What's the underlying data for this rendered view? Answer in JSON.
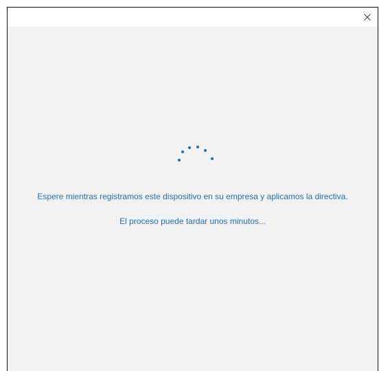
{
  "window": {
    "close_icon": "close-icon"
  },
  "spinner": {
    "icon": "loading-dots-icon",
    "color": "#1f6fb2"
  },
  "messages": {
    "primary": "Espere mientras registramos este dispositivo en su empresa y aplicamos la directiva.",
    "secondary": "El proceso puede tardar unos minutos..."
  },
  "colors": {
    "accent_text": "#1f6fb2",
    "background": "#f2f2f2",
    "titlebar": "#ffffff"
  }
}
